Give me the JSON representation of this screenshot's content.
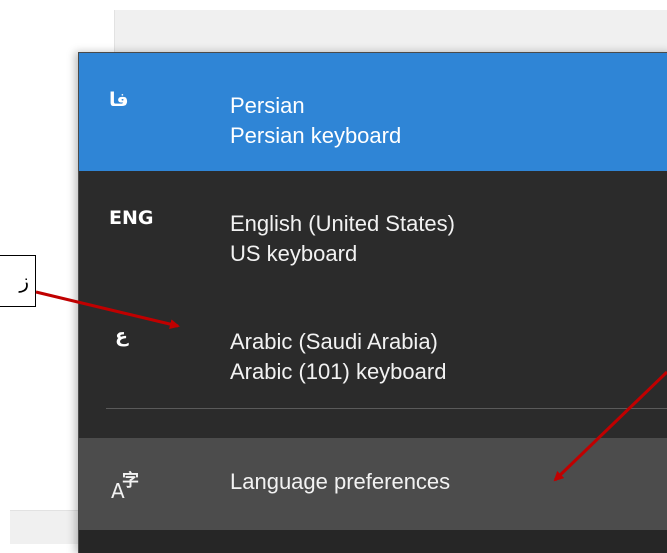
{
  "flyout": {
    "languages": [
      {
        "abbr": "فا",
        "name": "Persian",
        "keyboard": "Persian keyboard",
        "selected": true
      },
      {
        "abbr": "ENG",
        "name": "English (United States)",
        "keyboard": "US keyboard",
        "selected": false
      },
      {
        "abbr": "ع",
        "name": "Arabic (Saudi Arabia)",
        "keyboard": "Arabic (101) keyboard",
        "selected": false
      }
    ],
    "preferences_label": "Language preferences",
    "preferences_icon": "language-preferences-icon"
  },
  "callout": {
    "text": "ز"
  },
  "colors": {
    "flyout_bg": "#2b2b2b",
    "selected_bg": "#2f85d6",
    "hover_bg": "#4c4c4c",
    "arrow": "#c00000"
  }
}
